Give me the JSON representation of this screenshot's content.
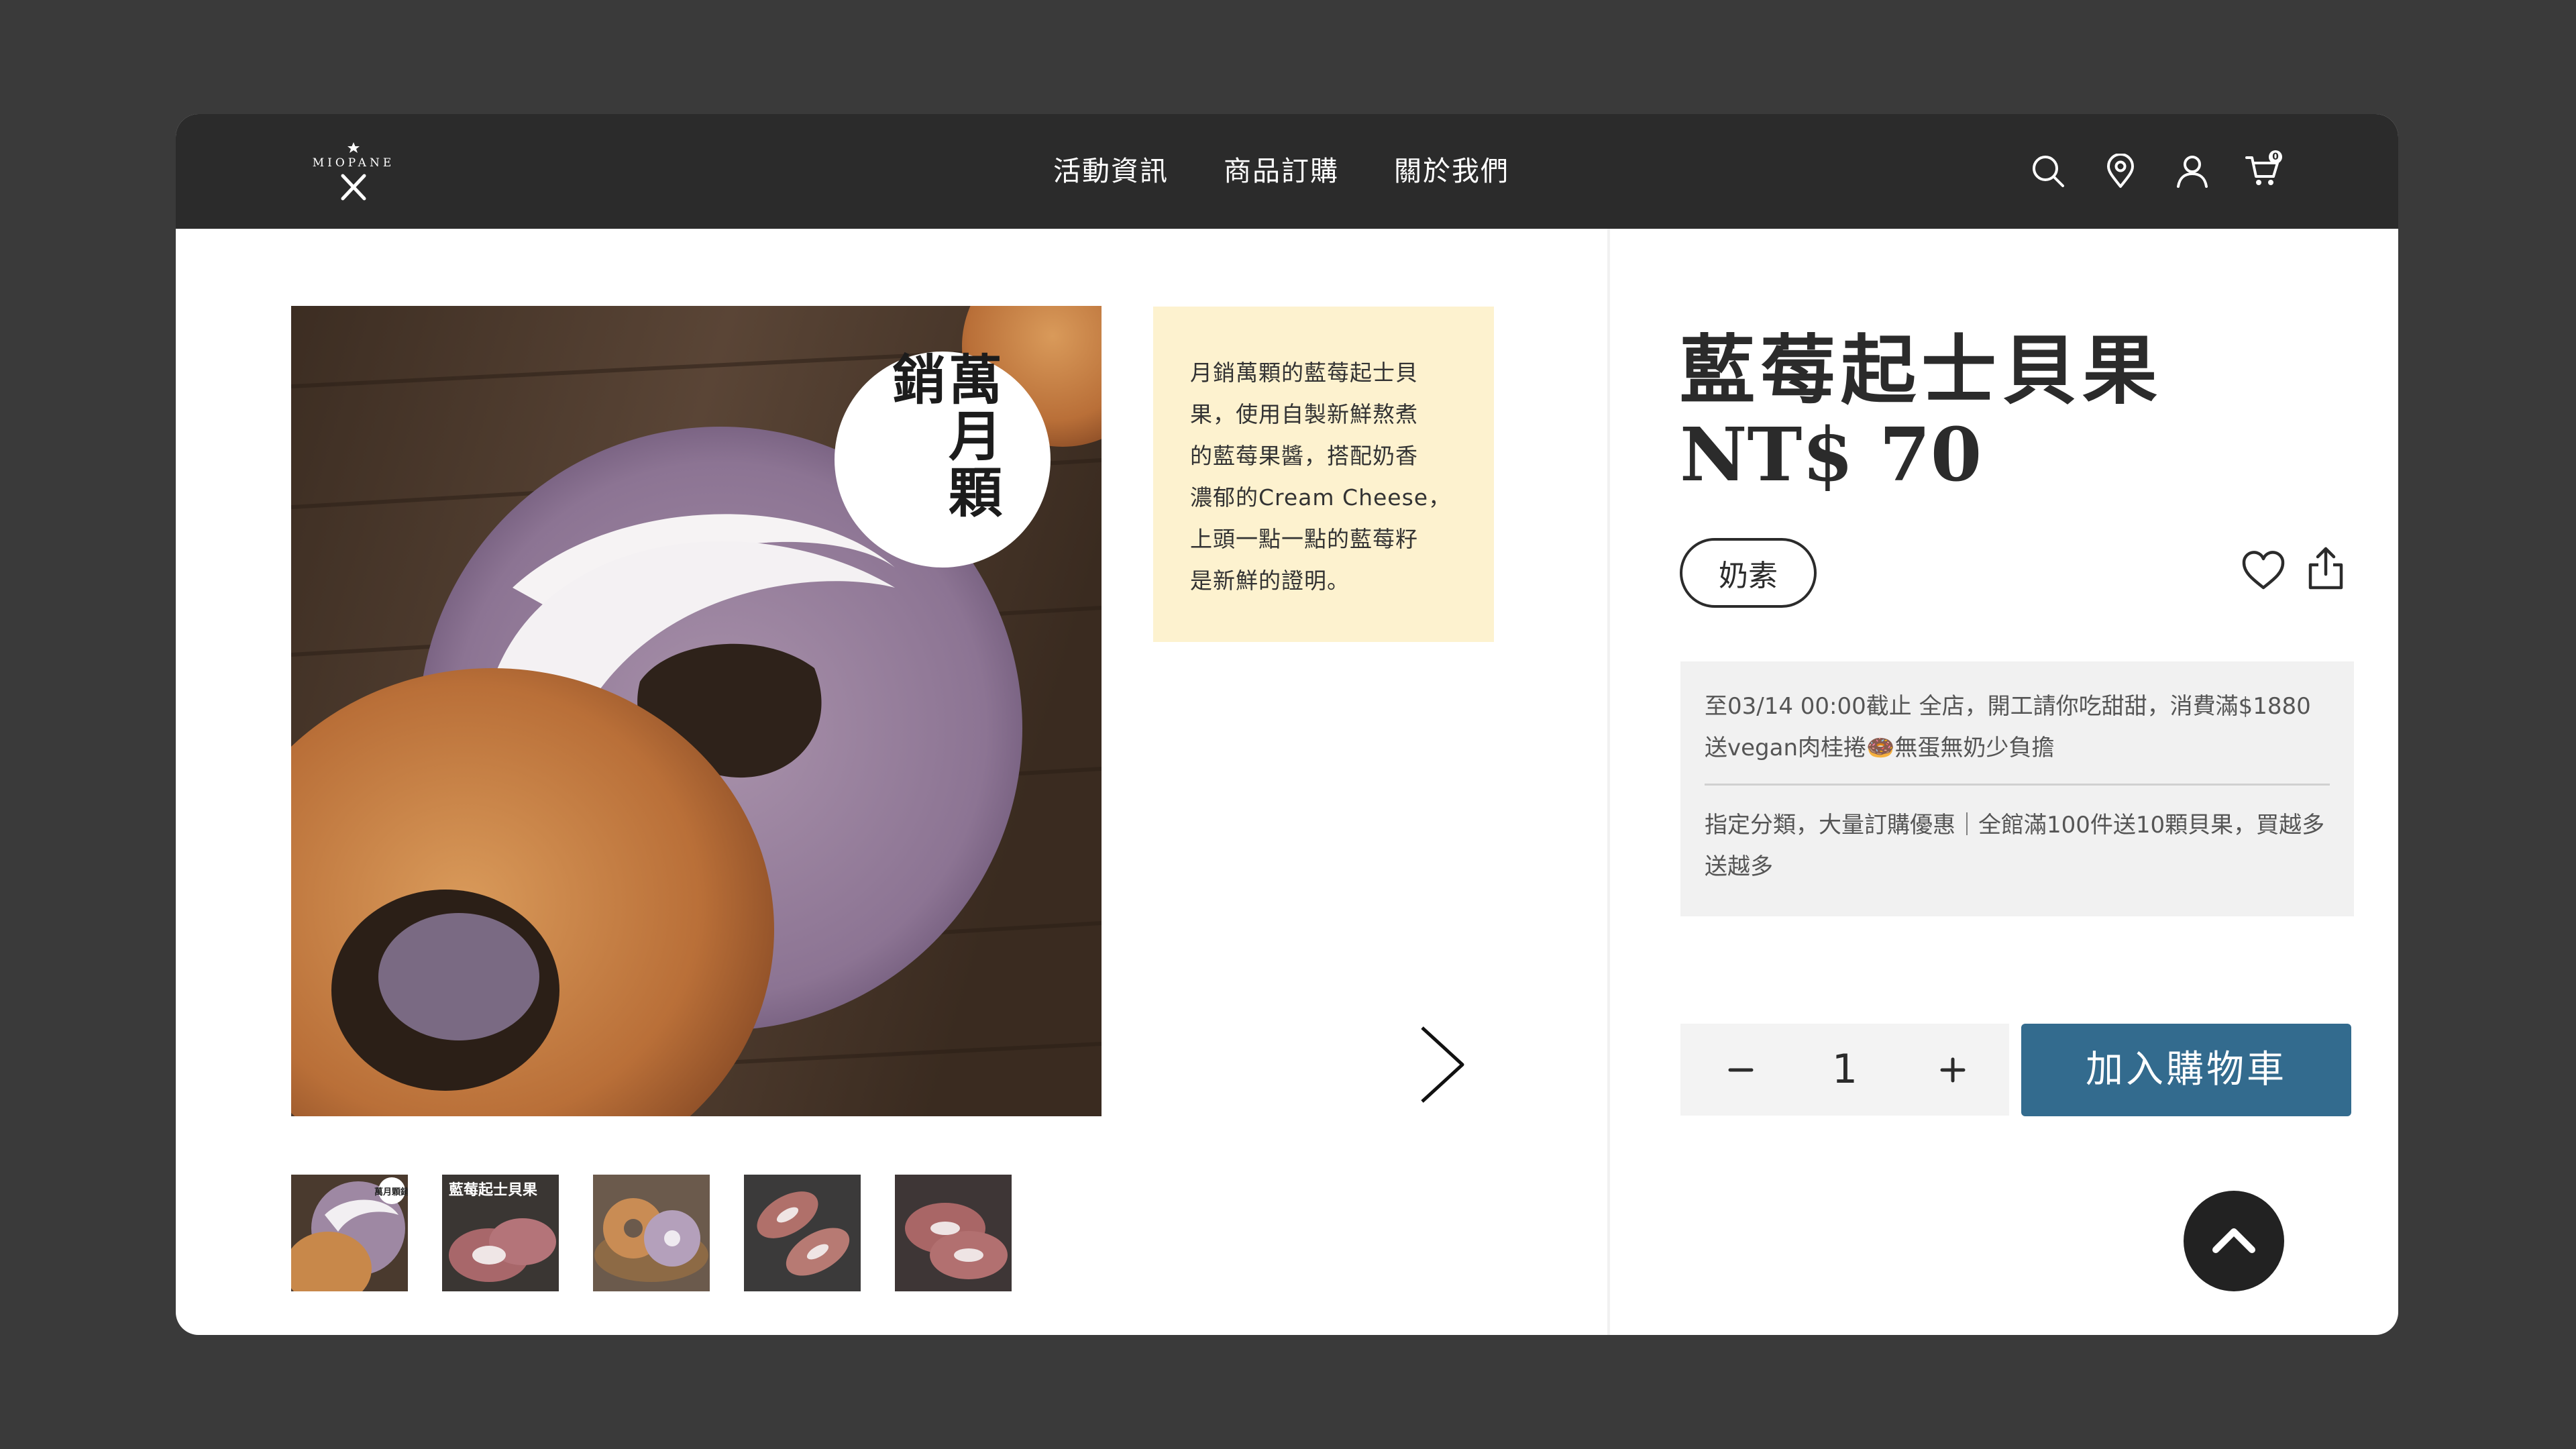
{
  "brand": {
    "logo_text": "MIOPANE"
  },
  "nav": {
    "links": [
      "活動資訊",
      "商品訂購",
      "關於我們"
    ],
    "icons": [
      "search-icon",
      "location-pin-icon",
      "user-icon",
      "cart-icon"
    ],
    "cart_count": "0"
  },
  "gallery": {
    "badge_text": "萬月顆銷",
    "thumbnail_count": 5,
    "thumbnail_badge_text": "萬月顆銷",
    "thumbnail_title_text": "藍莓起士貝果"
  },
  "description": {
    "lines": [
      "月銷萬顆的藍莓起士貝",
      "果，使用自製新鮮熬煮",
      "的藍莓果醬，搭配奶香",
      "濃郁的Cream Cheese，",
      "上頭一點一點的藍莓籽",
      "是新鮮的證明。"
    ]
  },
  "product": {
    "title": "藍莓起士貝果",
    "price": "NT$ 70",
    "tag": "奶素",
    "promotions": [
      "至03/14 00:00截止 全店，開工請你吃甜甜，消費滿$1880送vegan肉桂捲🍩無蛋無奶少負擔",
      "指定分類，大量訂購優惠｜全館滿100件送10顆貝果，買越多送越多"
    ],
    "quantity": "1",
    "add_to_cart_label": "加入購物車"
  },
  "colors": {
    "navbar": "#2b2b2b",
    "accent_button": "#336b8e",
    "description_bg": "#fdf2cf",
    "promo_bg": "#f1f1f1",
    "page_bg": "#3a3a3a"
  }
}
